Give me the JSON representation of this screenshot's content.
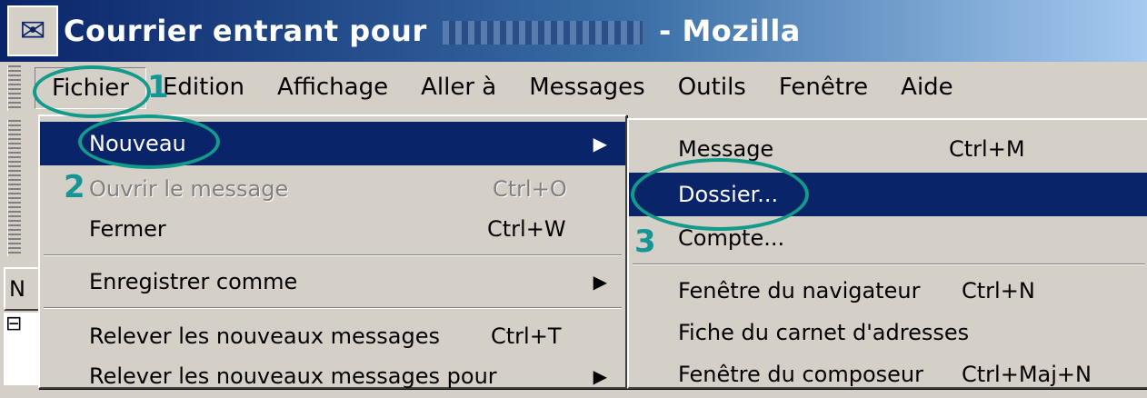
{
  "window": {
    "title_prefix": "Courrier entrant pour",
    "title_suffix": "- Mozilla",
    "icon": "mozilla-mail-icon"
  },
  "menubar": {
    "items": [
      "Fichier",
      "Edition",
      "Affichage",
      "Aller à",
      "Messages",
      "Outils",
      "Fenêtre",
      "Aide"
    ]
  },
  "file_menu": {
    "items": [
      {
        "label": "Nouveau",
        "shortcut": "",
        "submenu": true,
        "state": "selected"
      },
      {
        "label": "Ouvrir le message",
        "shortcut": "Ctrl+O",
        "submenu": false,
        "state": "disabled"
      },
      {
        "label": "Fermer",
        "shortcut": "Ctrl+W",
        "submenu": false,
        "state": "normal"
      },
      {
        "label": "Enregistrer comme",
        "shortcut": "",
        "submenu": true,
        "state": "normal"
      },
      {
        "label": "Relever les nouveaux messages",
        "shortcut": "Ctrl+T",
        "submenu": false,
        "state": "normal"
      },
      {
        "label": "Relever les nouveaux messages pour",
        "shortcut": "",
        "submenu": true,
        "state": "normal"
      }
    ]
  },
  "new_submenu": {
    "items": [
      {
        "label": "Message",
        "shortcut": "Ctrl+M",
        "state": "normal"
      },
      {
        "label": "Dossier...",
        "shortcut": "",
        "state": "selected"
      },
      {
        "label": "Compte...",
        "shortcut": "",
        "state": "normal"
      },
      {
        "label": "Fenêtre du navigateur",
        "shortcut": "Ctrl+N",
        "state": "normal"
      },
      {
        "label": "Fiche du carnet d'adresses",
        "shortcut": "",
        "state": "normal"
      },
      {
        "label": "Fenêtre du composeur",
        "shortcut": "Ctrl+Maj+N",
        "state": "normal"
      }
    ]
  },
  "annotations": {
    "step1": "1",
    "step2": "2",
    "step3": "3",
    "color": "#129a8a"
  },
  "left_panel": {
    "header_fragment": "N",
    "tree_toggle": "⊟"
  }
}
